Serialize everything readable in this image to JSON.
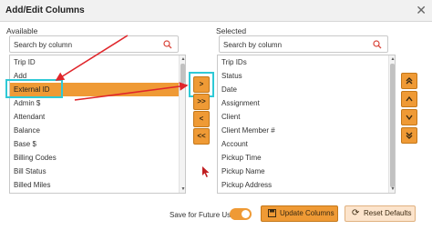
{
  "dialog": {
    "title": "Add/Edit Columns",
    "close_icon": "✕"
  },
  "available": {
    "label": "Available",
    "search_placeholder": "Search by column",
    "items": [
      "Trip ID",
      "Add",
      "External ID",
      "Admin $",
      "Attendant",
      "Balance",
      "Base $",
      "Billing Codes",
      "Bill Status",
      "Billed Miles"
    ],
    "selected_index": 2
  },
  "selected": {
    "label": "Selected",
    "search_placeholder": "Search by column",
    "items": [
      "Trip IDs",
      "Status",
      "Date",
      "Assignment",
      "Client",
      "Client Member #",
      "Account",
      "Pickup Time",
      "Pickup Name",
      "Pickup Address"
    ]
  },
  "transfer_buttons": {
    "move_right": ">",
    "move_all_right": ">>",
    "move_left": "<",
    "move_all_left": "<<"
  },
  "order_buttons": {
    "move_top": "top-icon",
    "move_up": "up-icon",
    "move_down": "down-icon",
    "move_bottom": "bottom-icon"
  },
  "footer": {
    "save_label": "Save for Future Use",
    "save_enabled": true,
    "update_label": "Update Columns",
    "reset_label": "Reset Defaults"
  },
  "colors": {
    "accent": "#ef9a35",
    "highlight": "#2fc9d6",
    "annotation": "#e0262b"
  }
}
